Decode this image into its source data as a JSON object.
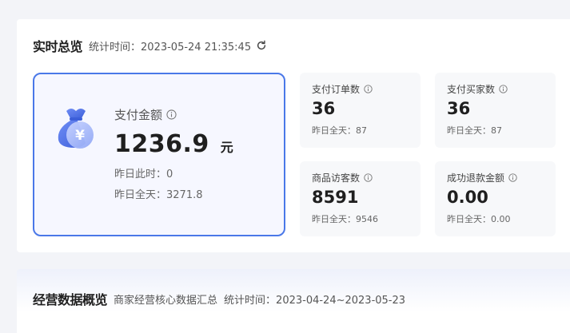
{
  "realtime": {
    "title": "实时总览",
    "time_label": "统计时间：",
    "time_value": "2023-05-24 21:35:45"
  },
  "payment": {
    "label": "支付金额",
    "value": "1236.9",
    "unit": "元",
    "same_time_yesterday": "昨日此时：0",
    "yesterday_full": "昨日全天：3271.8"
  },
  "stats": [
    {
      "label": "支付订单数",
      "value": "36",
      "yesterday": "昨日全天：87"
    },
    {
      "label": "支付买家数",
      "value": "36",
      "yesterday": "昨日全天：87"
    },
    {
      "label": "商品访客数",
      "value": "8591",
      "yesterday": "昨日全天：9546"
    },
    {
      "label": "成功退款金额",
      "value": "0.00",
      "yesterday": "昨日全天：0.00"
    }
  ],
  "business": {
    "title": "经营数据概览",
    "subtitle": "商家经营核心数据汇总",
    "time_label": "统计时间：",
    "time_value": "2023-04-24~2023-05-23"
  },
  "colors": {
    "accent": "#4a78e8",
    "card_bg": "#f6f7ff",
    "stat_bg": "#f7f8fa"
  }
}
